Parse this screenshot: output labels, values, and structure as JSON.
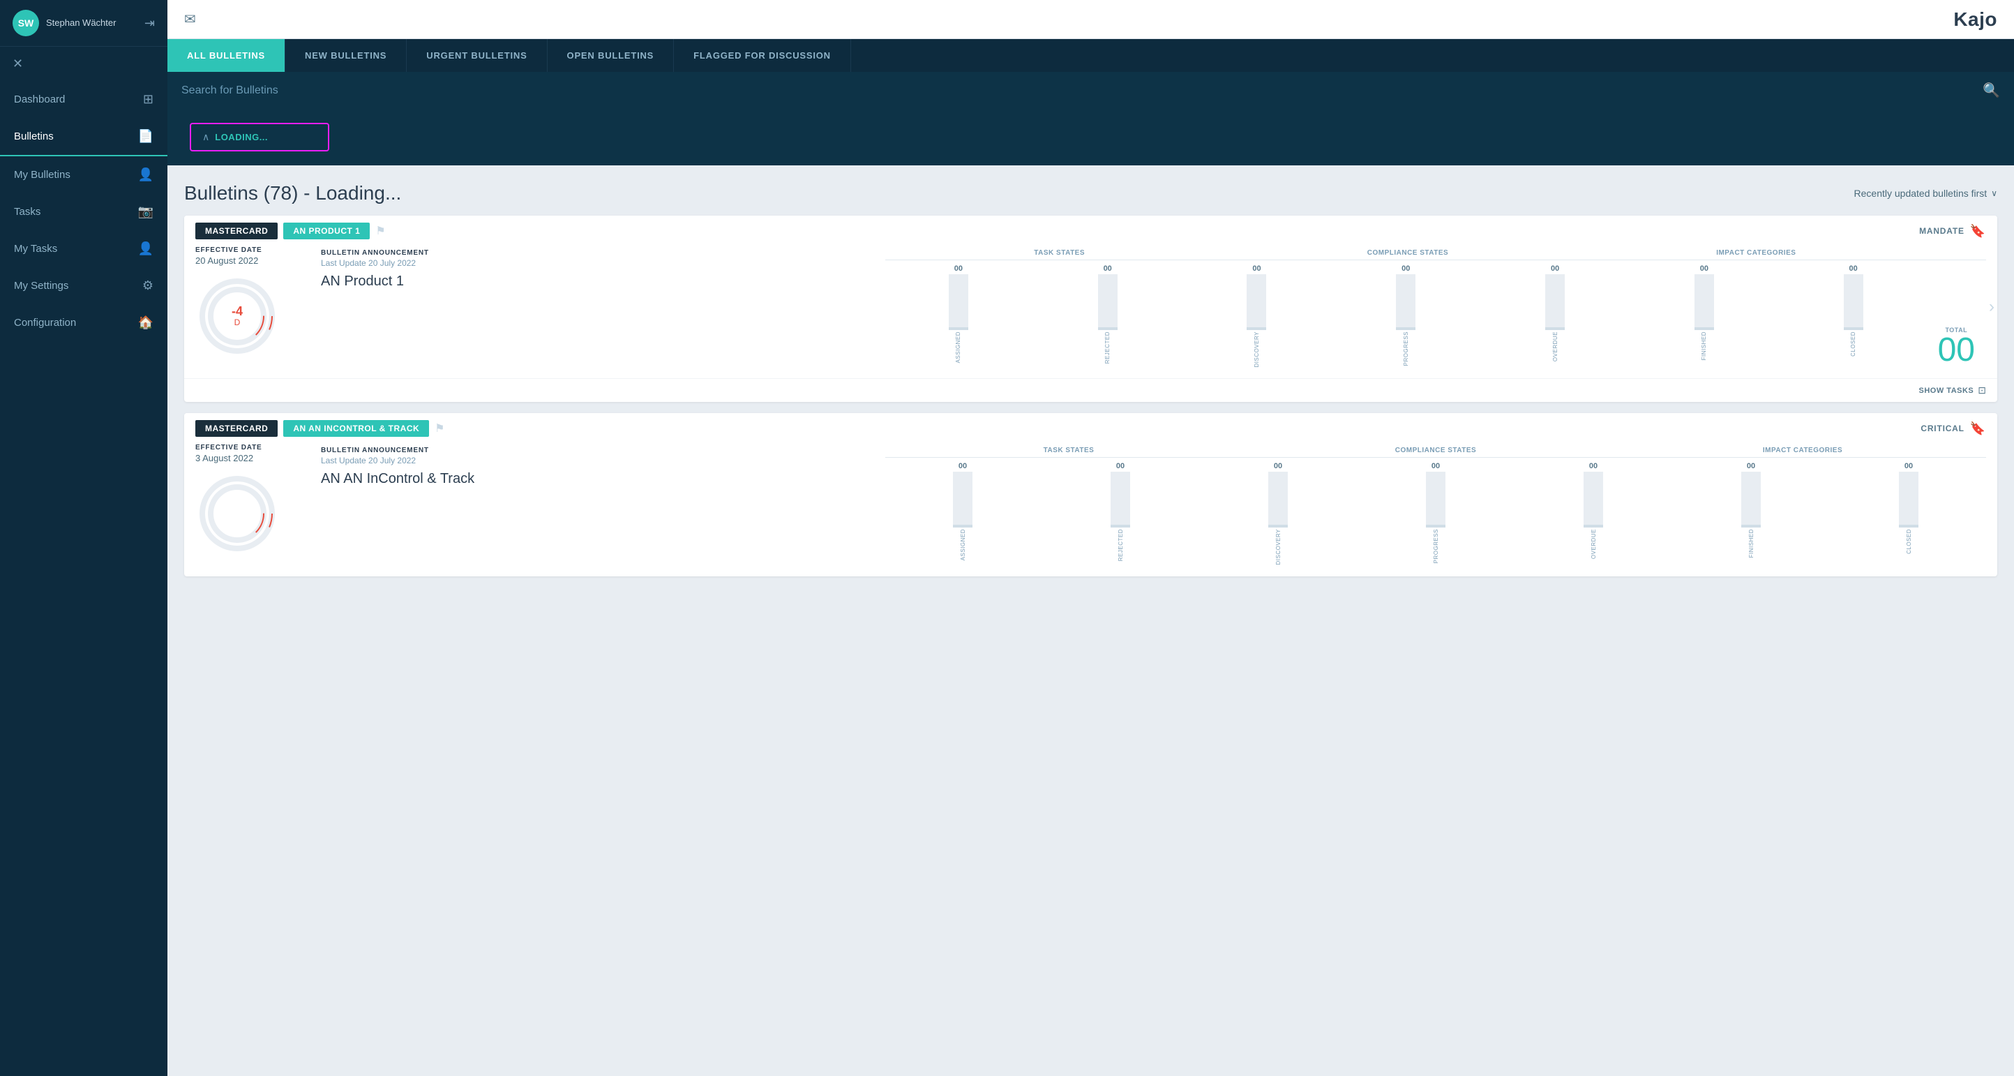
{
  "sidebar": {
    "user": {
      "initials": "SW",
      "name": "Stephan Wächter"
    },
    "nav_items": [
      {
        "id": "dashboard",
        "label": "Dashboard",
        "icon": "⊞"
      },
      {
        "id": "bulletins",
        "label": "Bulletins",
        "icon": "📄",
        "active": true
      },
      {
        "id": "my_bulletins",
        "label": "My Bulletins",
        "icon": "👤"
      },
      {
        "id": "tasks",
        "label": "Tasks",
        "icon": "📷"
      },
      {
        "id": "my_tasks",
        "label": "My Tasks",
        "icon": "👤"
      },
      {
        "id": "my_settings",
        "label": "My Settings",
        "icon": "⚙"
      },
      {
        "id": "configuration",
        "label": "Configuration",
        "icon": "🏠"
      }
    ]
  },
  "topbar": {
    "title": "Kajo",
    "mail_icon": "✉"
  },
  "tabs": [
    {
      "id": "all",
      "label": "ALL BULLETINS",
      "active": true
    },
    {
      "id": "new",
      "label": "NEW BULLETINS"
    },
    {
      "id": "urgent",
      "label": "URGENT BULLETINS"
    },
    {
      "id": "open",
      "label": "OPEN BULLETINS"
    },
    {
      "id": "flagged",
      "label": "FLAGGED FOR DISCUSSION"
    }
  ],
  "search": {
    "placeholder": "Search for Bulletins"
  },
  "loading_dropdown": {
    "text": "LOADING..."
  },
  "bulletins_header": {
    "title": "Bulletins (78) - Loading...",
    "sort_label": "Recently updated bulletins first"
  },
  "cards": [
    {
      "id": "card1",
      "tags": [
        "MASTERCARD",
        "AN PRODUCT 1"
      ],
      "mandate_label": "MANDATE",
      "effective_date_label": "EFFECTIVE DATE",
      "effective_date": "20 August 2022",
      "bulletin_type": "BULLETIN ANNOUNCEMENT",
      "last_update": "Last Update 20 July 2022",
      "name": "AN Product 1",
      "donut_number": "-4",
      "donut_letter": "D",
      "task_states_label": "TASK STATES",
      "compliance_states_label": "COMPLIANCE STATES",
      "impact_categories_label": "IMPACT CATEGORIES",
      "columns": [
        {
          "label": "ASSIGNED",
          "value": "00"
        },
        {
          "label": "REJECTED",
          "value": "00"
        },
        {
          "label": "DISCOVERY",
          "value": "00"
        },
        {
          "label": "PROGRESS",
          "value": "00"
        },
        {
          "label": "OVERDUE",
          "value": "00"
        },
        {
          "label": "FINISHED",
          "value": "00"
        },
        {
          "label": "CLOSED",
          "value": "00"
        }
      ],
      "total_label": "TOTAL",
      "total_value": "00",
      "show_tasks_label": "SHOW TASKS"
    },
    {
      "id": "card2",
      "tags": [
        "MASTERCARD",
        "AN AN INCONTROL & TRACK"
      ],
      "critical_label": "CRITICAL",
      "effective_date_label": "EFFECTIVE DATE",
      "effective_date": "3 August 2022",
      "bulletin_type": "BULLETIN ANNOUNCEMENT",
      "last_update": "Last Update 20 July 2022",
      "name": "AN AN InControl & Track",
      "task_states_label": "TASK STATES",
      "compliance_states_label": "COMPLIANCE STATES",
      "impact_categories_label": "IMPACT CATEGORIES",
      "columns": [
        {
          "label": "ASSIGNED",
          "value": "00"
        },
        {
          "label": "REJECTED",
          "value": "00"
        },
        {
          "label": "DISCOVERY",
          "value": "00"
        },
        {
          "label": "PROGRESS",
          "value": "00"
        },
        {
          "label": "OVERDUE",
          "value": "00"
        },
        {
          "label": "FINISHED",
          "value": "00"
        },
        {
          "label": "CLOSED",
          "value": "00"
        }
      ]
    }
  ]
}
